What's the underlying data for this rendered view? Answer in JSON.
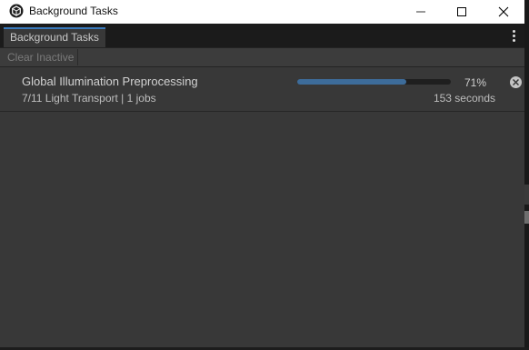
{
  "window": {
    "title": "Background Tasks",
    "icon": "unity-cube-icon"
  },
  "tab": {
    "label": "Background Tasks"
  },
  "toolbar": {
    "clear_inactive_label": "Clear Inactive"
  },
  "tasks": [
    {
      "name": "Global Illumination Preprocessing",
      "detail": "7/11 Light Transport | 1 jobs",
      "progress_percent": 71,
      "progress_label": "71%",
      "remaining": "153 seconds"
    }
  ],
  "colors": {
    "accent": "#3a79bb",
    "progress_fill": "#3d6c9a",
    "panel_bg": "#383838"
  }
}
